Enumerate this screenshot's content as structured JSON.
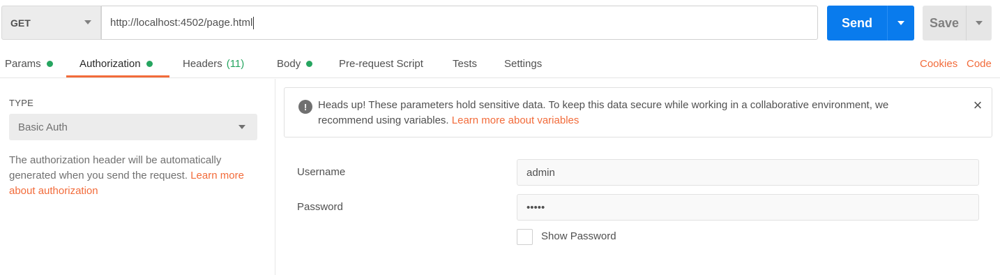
{
  "request": {
    "method": "GET",
    "url": "http://localhost:4502/page.html",
    "send_label": "Send",
    "save_label": "Save"
  },
  "tabs": [
    {
      "label": "Params",
      "dot": true
    },
    {
      "label": "Authorization",
      "dot": true,
      "active": true
    },
    {
      "label": "Headers",
      "count": "(11)"
    },
    {
      "label": "Body",
      "dot": true
    },
    {
      "label": "Pre-request Script"
    },
    {
      "label": "Tests"
    },
    {
      "label": "Settings"
    }
  ],
  "right_links": {
    "cookies": "Cookies",
    "code": "Code"
  },
  "auth": {
    "type_label": "TYPE",
    "type_value": "Basic Auth",
    "description": "The authorization header will be automatically generated when you send the request.",
    "learn_more": "Learn more about authorization"
  },
  "banner": {
    "text": "Heads up! These parameters hold sensitive data. To keep this data secure while working in a collaborative environment, we recommend using variables.",
    "link": "Learn more about variables",
    "icon": "!",
    "close": "×"
  },
  "form": {
    "username_label": "Username",
    "username_value": "admin",
    "password_label": "Password",
    "password_value": "•••••",
    "show_password_label": "Show Password"
  },
  "colors": {
    "accent": "#f26b3a",
    "send": "#097bed",
    "dot": "#26a560"
  }
}
